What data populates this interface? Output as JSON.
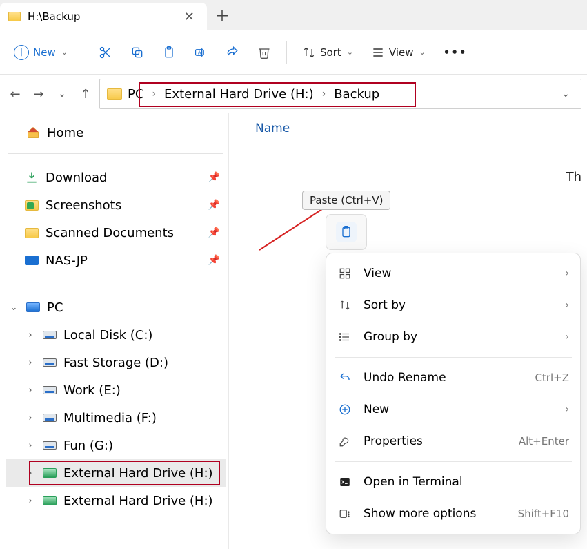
{
  "window": {
    "tab_title": "H:\\Backup"
  },
  "toolbar": {
    "new_label": "New",
    "sort_label": "Sort",
    "view_label": "View"
  },
  "breadcrumbs": {
    "items": [
      "PC",
      "External Hard Drive (H:)",
      "Backup"
    ]
  },
  "sidebar": {
    "home": "Home",
    "quick_access": [
      {
        "label": "Download"
      },
      {
        "label": "Screenshots"
      },
      {
        "label": "Scanned Documents"
      },
      {
        "label": "NAS-JP"
      }
    ],
    "pc_label": "PC",
    "drives": [
      {
        "label": "Local Disk (C:)"
      },
      {
        "label": "Fast Storage (D:)"
      },
      {
        "label": "Work (E:)"
      },
      {
        "label": "Multimedia (F:)"
      },
      {
        "label": "Fun (G:)"
      },
      {
        "label": "External Hard Drive (H:)",
        "highlighted": true
      },
      {
        "label": "External Hard Drive (H:)"
      }
    ]
  },
  "content": {
    "column_header": "Name",
    "empty_hint_partial": "Th"
  },
  "tooltip": {
    "paste": "Paste (Ctrl+V)"
  },
  "context_menu": {
    "items": [
      {
        "label": "View",
        "submenu": true
      },
      {
        "label": "Sort by",
        "submenu": true
      },
      {
        "label": "Group by",
        "submenu": true
      }
    ],
    "items2": [
      {
        "label": "Undo Rename",
        "shortcut": "Ctrl+Z"
      },
      {
        "label": "New",
        "submenu": true
      },
      {
        "label": "Properties",
        "shortcut": "Alt+Enter"
      }
    ],
    "items3": [
      {
        "label": "Open in Terminal"
      },
      {
        "label": "Show more options",
        "shortcut": "Shift+F10"
      }
    ]
  }
}
